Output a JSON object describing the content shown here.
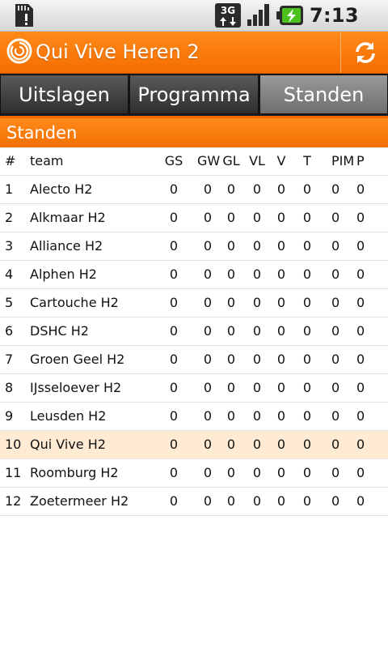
{
  "status_bar": {
    "time": "7:13 PM",
    "network": "3G",
    "icons": [
      "sd-card-icon",
      "3g-network-icon",
      "signal-strength-icon",
      "battery-charging-icon"
    ]
  },
  "title_bar": {
    "title": "Qui Vive Heren 2",
    "logo_icon": "app-logo-icon",
    "refresh_icon": "refresh-icon"
  },
  "tabs": [
    {
      "label": "Uitslagen",
      "active": false
    },
    {
      "label": "Programma",
      "active": false
    },
    {
      "label": "Standen",
      "active": true
    }
  ],
  "section": {
    "title": "Standen"
  },
  "columns": {
    "rank": "#",
    "team": "team",
    "gs": "GS",
    "gw": "GW",
    "gl": "GL",
    "vl": "VL",
    "v": "V",
    "t": "T",
    "pim": "PIM",
    "p": "P"
  },
  "rows": [
    {
      "rank": "1",
      "team": "Alecto H2",
      "gs": "0",
      "gw": "0",
      "gl": "0",
      "vl": "0",
      "v": "0",
      "t": "0",
      "pim": "0",
      "p": "0",
      "highlight": false
    },
    {
      "rank": "2",
      "team": "Alkmaar H2",
      "gs": "0",
      "gw": "0",
      "gl": "0",
      "vl": "0",
      "v": "0",
      "t": "0",
      "pim": "0",
      "p": "0",
      "highlight": false
    },
    {
      "rank": "3",
      "team": "Alliance H2",
      "gs": "0",
      "gw": "0",
      "gl": "0",
      "vl": "0",
      "v": "0",
      "t": "0",
      "pim": "0",
      "p": "0",
      "highlight": false
    },
    {
      "rank": "4",
      "team": "Alphen H2",
      "gs": "0",
      "gw": "0",
      "gl": "0",
      "vl": "0",
      "v": "0",
      "t": "0",
      "pim": "0",
      "p": "0",
      "highlight": false
    },
    {
      "rank": "5",
      "team": "Cartouche H2",
      "gs": "0",
      "gw": "0",
      "gl": "0",
      "vl": "0",
      "v": "0",
      "t": "0",
      "pim": "0",
      "p": "0",
      "highlight": false
    },
    {
      "rank": "6",
      "team": "DSHC H2",
      "gs": "0",
      "gw": "0",
      "gl": "0",
      "vl": "0",
      "v": "0",
      "t": "0",
      "pim": "0",
      "p": "0",
      "highlight": false
    },
    {
      "rank": "7",
      "team": "Groen Geel H2",
      "gs": "0",
      "gw": "0",
      "gl": "0",
      "vl": "0",
      "v": "0",
      "t": "0",
      "pim": "0",
      "p": "0",
      "highlight": false
    },
    {
      "rank": "8",
      "team": "IJsseloever H2",
      "gs": "0",
      "gw": "0",
      "gl": "0",
      "vl": "0",
      "v": "0",
      "t": "0",
      "pim": "0",
      "p": "0",
      "highlight": false
    },
    {
      "rank": "9",
      "team": "Leusden H2",
      "gs": "0",
      "gw": "0",
      "gl": "0",
      "vl": "0",
      "v": "0",
      "t": "0",
      "pim": "0",
      "p": "0",
      "highlight": false
    },
    {
      "rank": "10",
      "team": "Qui Vive H2",
      "gs": "0",
      "gw": "0",
      "gl": "0",
      "vl": "0",
      "v": "0",
      "t": "0",
      "pim": "0",
      "p": "0",
      "highlight": true
    },
    {
      "rank": "11",
      "team": "Roomburg H2",
      "gs": "0",
      "gw": "0",
      "gl": "0",
      "vl": "0",
      "v": "0",
      "t": "0",
      "pim": "0",
      "p": "0",
      "highlight": false
    },
    {
      "rank": "12",
      "team": "Zoetermeer H2",
      "gs": "0",
      "gw": "0",
      "gl": "0",
      "vl": "0",
      "v": "0",
      "t": "0",
      "pim": "0",
      "p": "0",
      "highlight": false
    }
  ],
  "colors": {
    "accent_orange": "#f57400",
    "highlight_row": "#ffebd4",
    "tab_active": "#8a8a8a",
    "tab_inactive": "#3c3c3c"
  }
}
